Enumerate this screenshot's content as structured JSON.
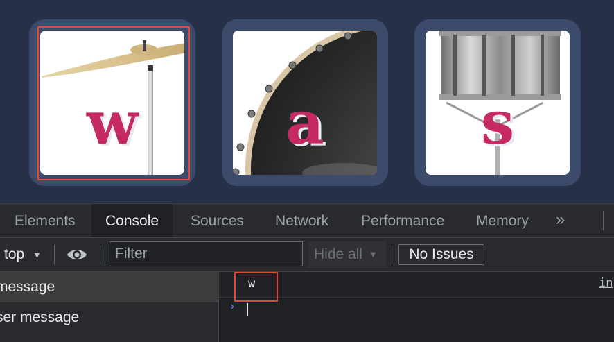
{
  "pads": [
    {
      "key": "w",
      "instrument": "crash cymbal"
    },
    {
      "key": "a",
      "instrument": "bass drum"
    },
    {
      "key": "s",
      "instrument": "snare drum"
    }
  ],
  "devtools": {
    "tabs": [
      "Elements",
      "Console",
      "Sources",
      "Network",
      "Performance",
      "Memory"
    ],
    "overflow_icon": "chevron-double-right-icon",
    "active_tab": "Console",
    "toolbar": {
      "context": "top",
      "eye_icon": "eye-icon",
      "filter_placeholder": "Filter",
      "levels": "Hide all",
      "issues": "No Issues"
    },
    "sidebar": [
      "message",
      "ser message"
    ],
    "console": {
      "log_text": "w",
      "source_link": "in"
    }
  },
  "colors": {
    "accent_letter": "#c52a63",
    "highlight_outline": "#e2482f",
    "prompt": "#4c8df6"
  }
}
